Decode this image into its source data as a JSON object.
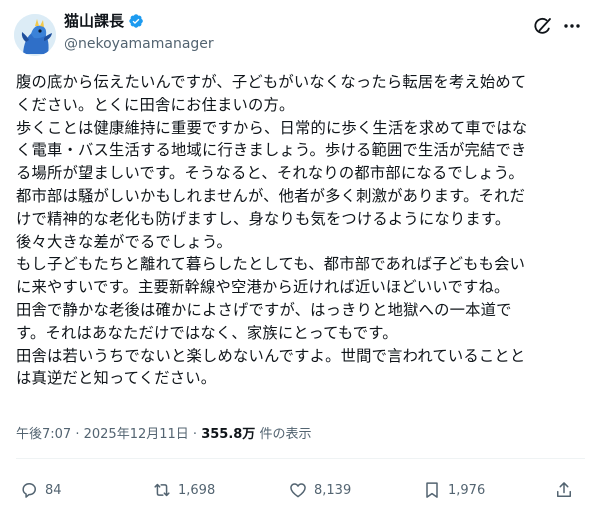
{
  "author": {
    "name": "猫山課長",
    "handle": "@nekoyamamanager",
    "avatar": "blue-dragon-avatar"
  },
  "icons": {
    "verified": "verified-badge-icon",
    "grok": "grok-icon",
    "more": "more-icon"
  },
  "post": {
    "lines": [
      "腹の底から伝えたいんですが、子どもがいなくなったら転居を考え始めて",
      "ください。とくに田舎にお住まいの方。",
      "歩くことは健康維持に重要ですから、日常的に歩く生活を求めて車ではな",
      "く電車・バス生活する地域に行きましょう。歩ける範囲で生活が完結でき",
      "る場所が望ましいです。そうなると、それなりの都市部になるでしょう。",
      "都市部は騒がしいかもしれませんが、他者が多く刺激があります。それだ",
      "けで精神的な老化も防げますし、身なりも気をつけるようになります。",
      "後々大きな差がでるでしょう。",
      "もし子どもたちと離れて暮らしたとしても、都市部であれば子どもも会い",
      "に来やすいです。主要新幹線や空港から近ければ近いほどいいですね。",
      "田舎で静かな老後は確かによさげですが、はっきりと地獄への一本道で",
      "す。それはあなただけではなく、家族にとってもです。",
      "田舎は若いうちでないと楽しめないんですよ。世間で言われていることと",
      "は真逆だと知ってください。"
    ]
  },
  "meta": {
    "time": "午後7:07",
    "separator": " · ",
    "date": "2025年12月11日",
    "views": "355.8万",
    "views_label": " 件の表示"
  },
  "actions": {
    "reply": {
      "icon": "reply-icon",
      "count": "84"
    },
    "repost": {
      "icon": "repost-icon",
      "count": "1,698"
    },
    "like": {
      "icon": "like-icon",
      "count": "8,139"
    },
    "bookmark": {
      "icon": "bookmark-icon",
      "count": "1,976"
    },
    "share": {
      "icon": "share-icon"
    }
  },
  "colors": {
    "text": "#0f1419",
    "secondary": "#536471",
    "verified": "#1d9bf0",
    "divider": "#eff3f4"
  }
}
